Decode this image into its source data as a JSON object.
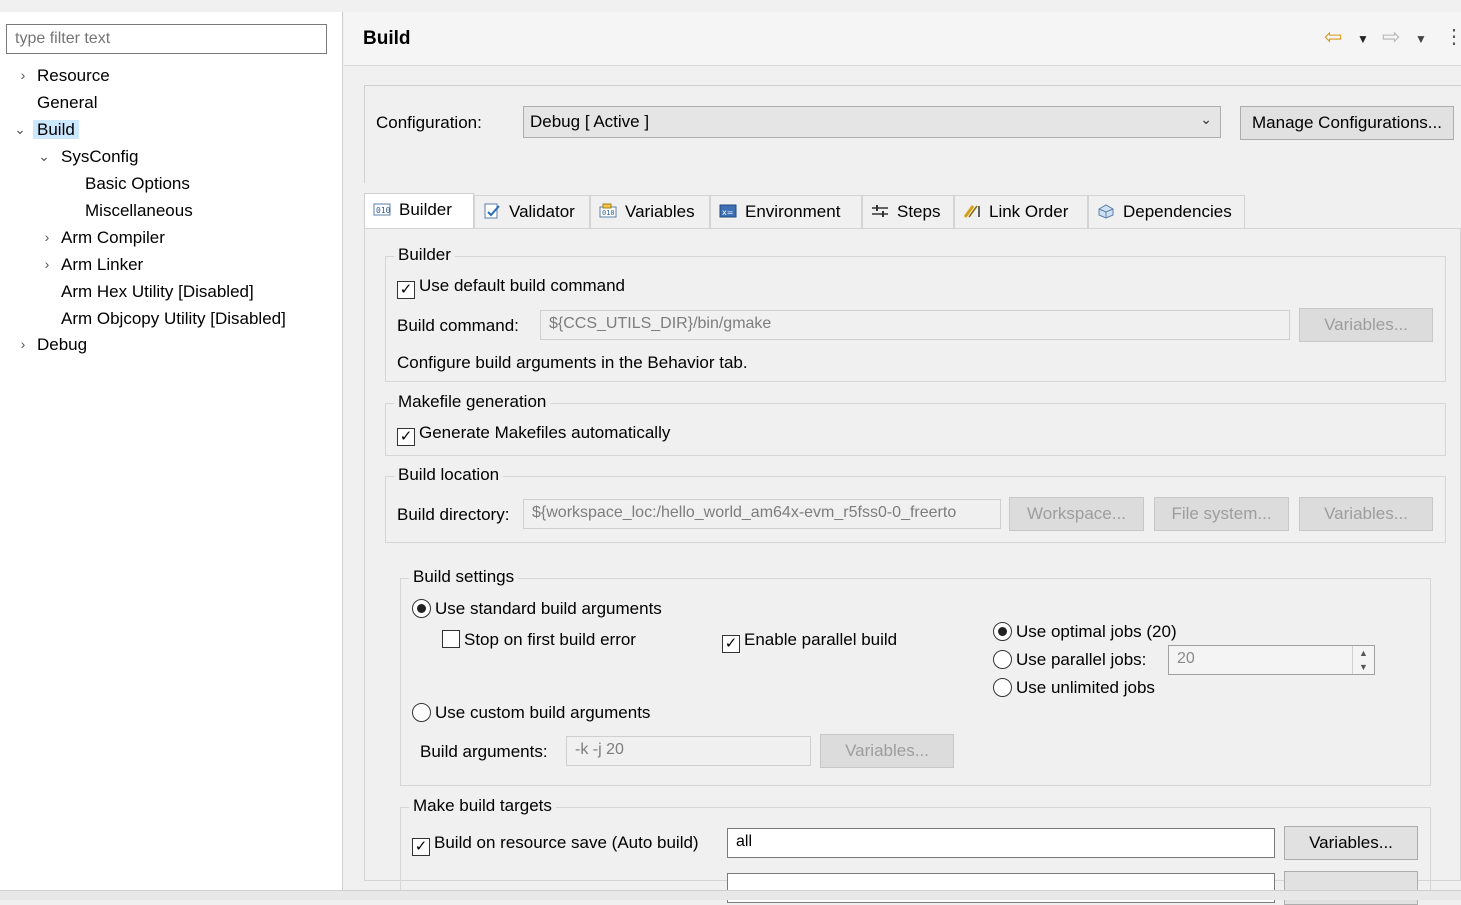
{
  "filter": {
    "placeholder": "type filter text"
  },
  "tree": {
    "resource": "Resource",
    "general": "General",
    "build": "Build",
    "sysconfig": "SysConfig",
    "basic_options": "Basic Options",
    "miscellaneous": "Miscellaneous",
    "arm_compiler": "Arm Compiler",
    "arm_linker": "Arm Linker",
    "arm_hex": "Arm Hex Utility  [Disabled]",
    "arm_objcopy": "Arm Objcopy Utility  [Disabled]",
    "debug": "Debug"
  },
  "header": {
    "title": "Build"
  },
  "configuration": {
    "label": "Configuration:",
    "value": "Debug  [ Active ]",
    "manage_button": "Manage Configurations..."
  },
  "tabs": {
    "builder": "Builder",
    "validator": "Validator",
    "variables": "Variables",
    "environment": "Environment",
    "steps": "Steps",
    "link_order": "Link Order",
    "dependencies": "Dependencies"
  },
  "builder_group": {
    "legend": "Builder",
    "use_default": "Use default build command",
    "use_default_checked": true,
    "command_label": "Build command:",
    "command_value": "${CCS_UTILS_DIR}/bin/gmake",
    "variables_button": "Variables...",
    "note": "Configure build arguments in the Behavior tab."
  },
  "makefile_group": {
    "legend": "Makefile generation",
    "generate": "Generate Makefiles automatically",
    "generate_checked": true
  },
  "location_group": {
    "legend": "Build location",
    "dir_label": "Build directory:",
    "dir_value": "${workspace_loc:/hello_world_am64x-evm_r5fss0-0_freerto",
    "workspace_button": "Workspace...",
    "filesystem_button": "File system...",
    "variables_button": "Variables..."
  },
  "settings_group": {
    "legend": "Build settings",
    "use_standard": "Use standard build arguments",
    "stop_first": "Stop on first build error",
    "enable_parallel": "Enable parallel build",
    "use_optimal": "Use optimal jobs (20)",
    "use_parallel": "Use parallel jobs:",
    "parallel_value": "20",
    "use_unlimited": "Use unlimited jobs",
    "use_custom": "Use custom build arguments",
    "args_label": "Build arguments:",
    "args_value": "-k -j 20",
    "variables_button": "Variables..."
  },
  "targets_group": {
    "legend": "Make build targets",
    "auto_build": "Build on resource save (Auto build)",
    "auto_value": "all",
    "variables_button": "Variables..."
  },
  "icons": {
    "back": "back-arrow-icon",
    "forward": "forward-arrow-icon",
    "menu": "view-menu-icon"
  },
  "colors": {
    "selection": "#cce8ff",
    "nav_arrow_active": "#d79a1e"
  }
}
